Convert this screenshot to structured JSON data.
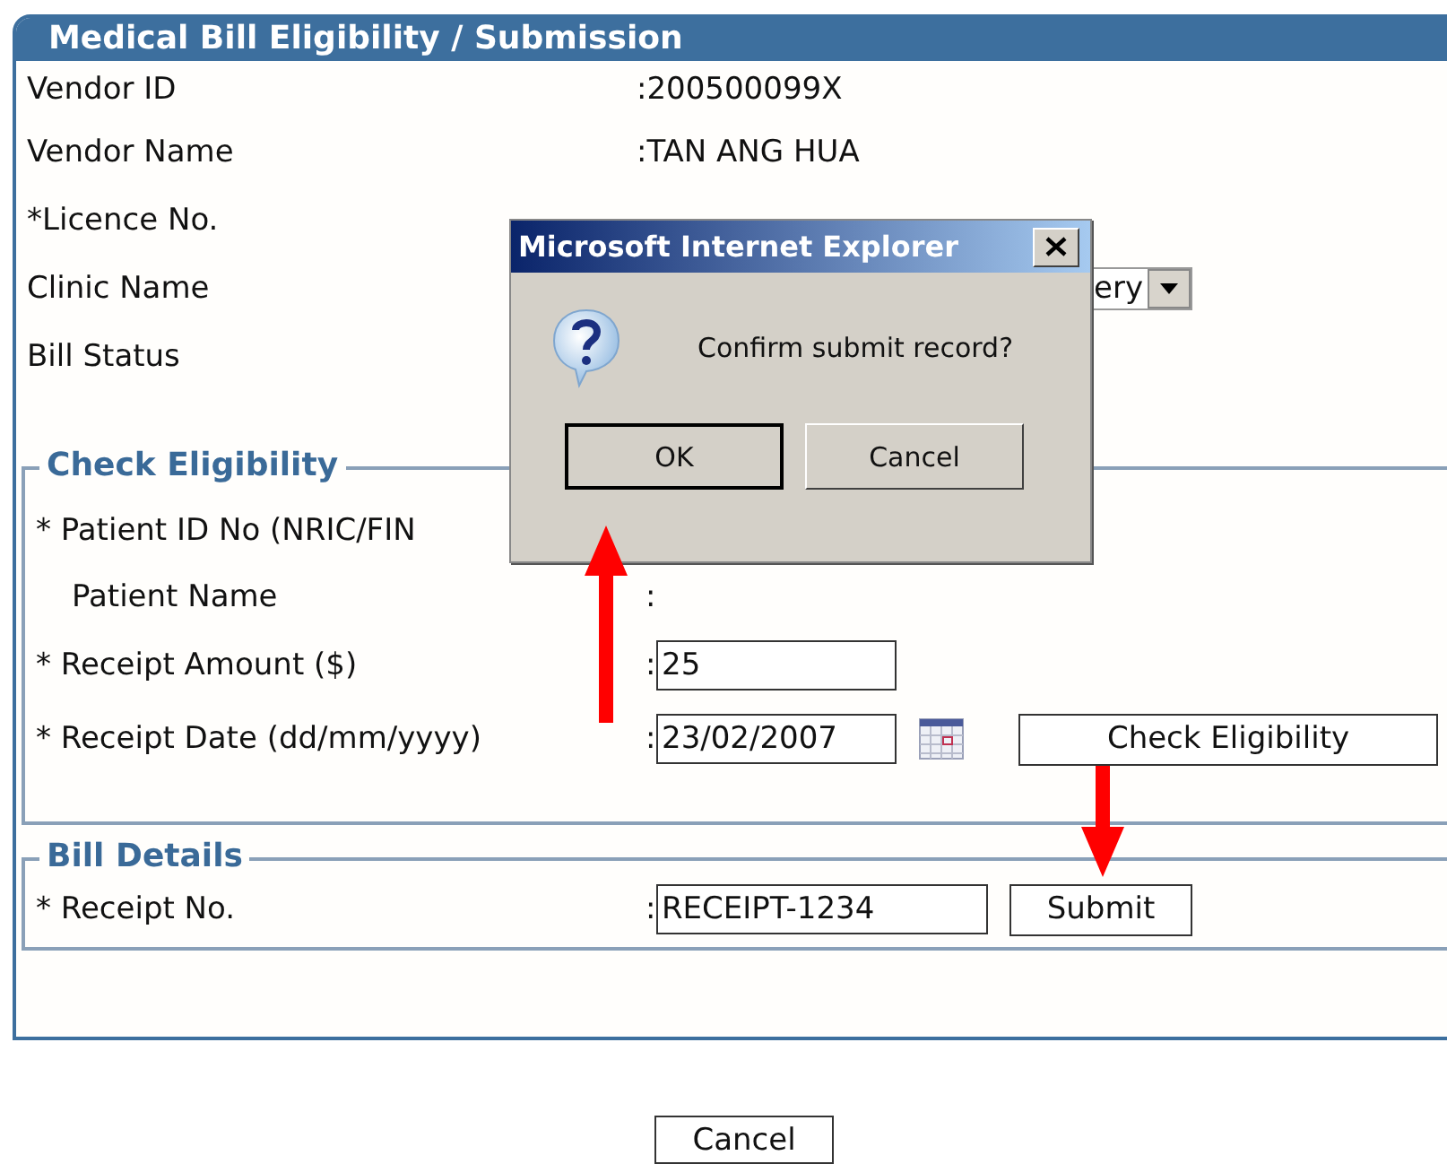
{
  "panel_title": "Medical Bill Eligibility / Submission",
  "vendor_fields": [
    {
      "label": "Vendor ID",
      "kind": "text",
      "value": ":200500099X"
    },
    {
      "label": "Vendor Name",
      "kind": "text",
      "value": ":TAN ANG HUA"
    },
    {
      "label": "*Licence No.",
      "kind": "blank"
    },
    {
      "label": "Clinic Name",
      "kind": "select",
      "value": "ery"
    },
    {
      "label": "Bill Status",
      "kind": "blank"
    }
  ],
  "check_eligibility": {
    "legend": "Check Eligibility",
    "button": "Check Eligibility",
    "rows": [
      {
        "label": "* Patient ID No (NRIC/FIN",
        "kind": "blank",
        "indented": false
      },
      {
        "label": "Patient Name",
        "kind": "text",
        "value": ":",
        "indented": true
      },
      {
        "label": "* Receipt Amount ($)",
        "kind": "input",
        "separator": ":",
        "value": "25",
        "indented": false
      },
      {
        "label": "* Receipt Date (dd/mm/yyyy)",
        "kind": "date",
        "separator": ":",
        "value": "23/02/2007",
        "indented": false
      }
    ]
  },
  "bill_details": {
    "legend": "Bill Details",
    "button": "Submit",
    "rows": [
      {
        "label": "* Receipt No.",
        "kind": "input",
        "separator": ":",
        "value": "RECEIPT-1234",
        "indented": false
      }
    ]
  },
  "footer_button": "Cancel",
  "dialog": {
    "title": "Microsoft Internet Explorer",
    "message": "Confirm submit record?",
    "buttons": [
      {
        "label": "OK",
        "focused": true
      },
      {
        "label": "Cancel",
        "focused": false
      }
    ]
  }
}
